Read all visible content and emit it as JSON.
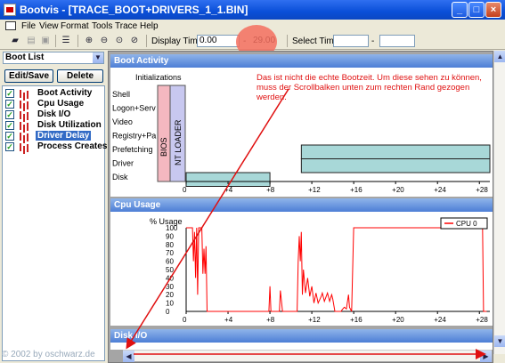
{
  "window": {
    "title": "Bootvis - [TRACE_BOOT+DRIVERS_1_1.BIN]",
    "buttons": [
      "_",
      "□",
      "×"
    ]
  },
  "menu": [
    "File",
    "View",
    "Format",
    "Tools",
    "Trace",
    "Help"
  ],
  "toolbar": {
    "display_time_label": "Display Time",
    "display_time_start": "0.00",
    "display_time_sep": "-",
    "display_time_end": "29.00",
    "select_time_label": "Select Time",
    "select_time_start": "",
    "select_time_sep": "-",
    "select_time_end": ""
  },
  "sidebar": {
    "dropdown_value": "Boot List",
    "edit_save": "Edit/Save",
    "delete": "Delete",
    "items": [
      {
        "label": "Boot Activity",
        "selected": false
      },
      {
        "label": "Cpu Usage",
        "selected": false
      },
      {
        "label": "Disk I/O",
        "selected": false
      },
      {
        "label": "Disk Utilization",
        "selected": false
      },
      {
        "label": "Driver Delay",
        "selected": true
      },
      {
        "label": "Process Creates",
        "selected": false
      }
    ]
  },
  "panes": {
    "boot_activity": "Boot Activity",
    "cpu_usage": "Cpu Usage",
    "disk_io": "Disk I/O"
  },
  "annotation": {
    "line1": "Das ist nicht die echte Bootzeit. Um diese sehen zu können,",
    "line2": "muss der Scrollbalken unten zum rechten Rand gezogen werden."
  },
  "copyright": "© 2002 by oschwarz.de",
  "colors": {
    "bar_fill": "#a8d8d8",
    "cpu_line": "#ff0000",
    "bios": "#f4b8c0",
    "nt_loader": "#c8c8f0",
    "annotation": "#e01010"
  },
  "chart_data": [
    {
      "type": "bar",
      "title": "Boot Activity",
      "ylabel": "Initializations",
      "categories": [
        "Shell",
        "Logon+Serv",
        "Video",
        "Registry+Pa",
        "Prefetching",
        "Driver",
        "Disk"
      ],
      "phases": [
        "BIOS",
        "NT LOADER"
      ],
      "x_ticks": [
        "0",
        "+4",
        "+8",
        "+12",
        "+16",
        "+20",
        "+24",
        "+28"
      ],
      "xlim": [
        0,
        29
      ],
      "bars": [
        {
          "category": "Disk",
          "start": 0,
          "end": 8
        },
        {
          "category": "Prefetching",
          "start": 11,
          "end": 29
        },
        {
          "category": "Driver",
          "start": 11,
          "end": 29
        }
      ]
    },
    {
      "type": "line",
      "title": "Cpu Usage",
      "ylabel": "% Usage",
      "y_ticks": [
        "100",
        "90",
        "80",
        "70",
        "60",
        "50",
        "40",
        "30",
        "20",
        "10",
        "0"
      ],
      "x_ticks": [
        "0",
        "+4",
        "+8",
        "+12",
        "+16",
        "+20",
        "+24",
        "+28"
      ],
      "ylim": [
        0,
        100
      ],
      "xlim": [
        0,
        29
      ],
      "series": [
        {
          "name": "CPU 0",
          "points": [
            [
              0.0,
              100
            ],
            [
              0.6,
              100
            ],
            [
              0.7,
              60
            ],
            [
              0.8,
              95
            ],
            [
              0.9,
              40
            ],
            [
              1.0,
              100
            ],
            [
              1.1,
              20
            ],
            [
              1.2,
              100
            ],
            [
              1.5,
              100
            ],
            [
              1.6,
              45
            ],
            [
              1.7,
              75
            ],
            [
              1.8,
              45
            ],
            [
              1.9,
              78
            ],
            [
              2.0,
              0
            ],
            [
              7.9,
              0
            ],
            [
              8.0,
              30
            ],
            [
              8.1,
              0
            ],
            [
              8.2,
              0
            ],
            [
              8.9,
              0
            ],
            [
              9.0,
              25
            ],
            [
              9.2,
              0
            ],
            [
              10.6,
              0
            ],
            [
              10.7,
              60
            ],
            [
              10.8,
              90
            ],
            [
              10.9,
              60
            ],
            [
              11.0,
              95
            ],
            [
              11.1,
              20
            ],
            [
              11.2,
              50
            ],
            [
              11.4,
              22
            ],
            [
              11.6,
              40
            ],
            [
              11.8,
              18
            ],
            [
              12.0,
              30
            ],
            [
              12.2,
              10
            ],
            [
              12.4,
              22
            ],
            [
              12.6,
              10
            ],
            [
              12.9,
              18
            ],
            [
              13.0,
              22
            ],
            [
              13.2,
              12
            ],
            [
              13.5,
              22
            ],
            [
              13.7,
              12
            ],
            [
              13.9,
              20
            ],
            [
              14.0,
              15
            ],
            [
              14.2,
              0
            ],
            [
              14.8,
              0
            ],
            [
              14.9,
              2
            ],
            [
              15.1,
              5
            ],
            [
              15.3,
              3
            ],
            [
              15.5,
              20
            ],
            [
              15.6,
              5
            ],
            [
              15.8,
              0
            ],
            [
              16.0,
              100
            ],
            [
              28.3,
              100
            ],
            [
              28.4,
              0
            ],
            [
              28.7,
              0
            ]
          ]
        }
      ]
    }
  ]
}
